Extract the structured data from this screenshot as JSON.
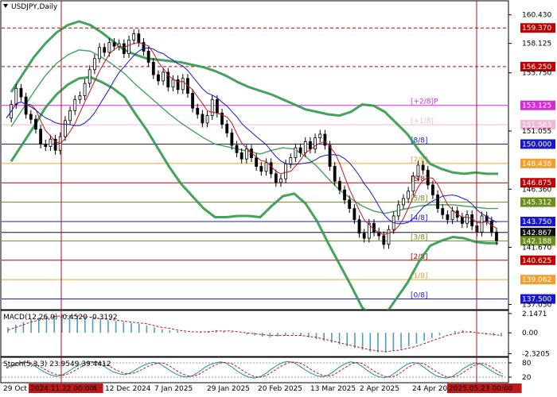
{
  "chart_data": [
    {
      "type": "candlestick",
      "title": "USDJPY,Daily",
      "ylim": [
        136.7,
        161.5
      ],
      "y_ticks": [
        "160.430",
        "158.125",
        "155.750",
        "153.125",
        "151.055",
        "148.438",
        "146.360",
        "143.750",
        "141.670",
        "139.062",
        "137.050"
      ],
      "x_ticks": [
        "29 Oct 2024",
        "2024.11.22 00:00",
        "4",
        "12 Dec 2024",
        "7 Jan 2025",
        "29 Jan 2025",
        "20 Feb 2025",
        "13 Mar 2025",
        "2 Apr 2025",
        "24 Apr 2025",
        "2025.05.23 00:00"
      ],
      "x_highlight_ticks": [
        "2024.11.22 00:00",
        "2025.05.23 00:00"
      ],
      "close_series": [
        152.1,
        153.2,
        154.5,
        153.8,
        152.4,
        152.0,
        151.2,
        150.0,
        149.8,
        150.4,
        149.5,
        150.6,
        151.9,
        152.7,
        153.6,
        153.9,
        154.9,
        156.0,
        156.9,
        157.8,
        157.4,
        158.2,
        157.9,
        158.1,
        157.3,
        158.4,
        158.9,
        158.2,
        157.5,
        156.6,
        155.6,
        155.1,
        155.8,
        154.6,
        155.2,
        154.4,
        155.3,
        154.1,
        152.9,
        152.4,
        151.7,
        152.3,
        153.6,
        152.5,
        151.6,
        150.9,
        149.9,
        149.3,
        148.8,
        149.6,
        148.9,
        148.2,
        147.8,
        148.5,
        147.6,
        146.9,
        147.2,
        148.4,
        148.9,
        149.7,
        149.3,
        150.2,
        149.6,
        150.5,
        150.8,
        149.9,
        148.2,
        147.0,
        146.3,
        145.5,
        144.8,
        143.9,
        142.8,
        142.4,
        143.6,
        142.9,
        142.6,
        141.9,
        143.1,
        144.2,
        145.1,
        145.6,
        146.2,
        147.4,
        148.3,
        147.9,
        146.7,
        145.9,
        144.8,
        144.3,
        143.9,
        144.6,
        144.1,
        143.6,
        144.3,
        143.4,
        142.9,
        144.2,
        143.8,
        142.9,
        142.2
      ],
      "bollinger": {
        "upper": [
          154.2,
          155.6,
          157.0,
          158.1,
          159.0,
          159.6,
          159.9,
          159.6,
          159.0,
          158.3,
          157.6,
          157.2,
          156.9,
          156.8,
          156.7,
          156.6,
          156.4,
          156.2,
          155.9,
          155.5,
          155.0,
          154.6,
          154.3,
          154.0,
          153.6,
          153.2,
          152.8,
          152.6,
          152.4,
          152.3,
          152.6,
          153.2,
          153.1,
          152.6,
          151.7,
          150.8,
          149.5,
          148.4,
          148.0,
          147.7,
          147.6,
          147.7,
          147.6,
          147.6
        ],
        "middle": [
          151.4,
          152.8,
          154.2,
          155.5,
          156.5,
          157.2,
          157.6,
          157.5,
          157.0,
          156.4,
          155.7,
          154.8,
          154.0,
          153.2,
          152.4,
          151.7,
          151.1,
          150.5,
          150.0,
          149.8,
          149.6,
          149.4,
          149.2,
          149.5,
          149.7,
          149.6,
          149.0,
          148.2,
          147.2,
          146.3,
          145.6,
          145.0,
          144.6,
          144.4,
          144.6,
          144.8,
          145.0,
          145.1,
          145.1,
          145.1,
          145.0,
          144.9,
          144.8,
          144.8
        ],
        "lower": [
          148.6,
          150.0,
          151.4,
          152.9,
          154.0,
          154.8,
          155.3,
          155.4,
          155.0,
          154.5,
          153.8,
          152.4,
          151.1,
          149.6,
          148.1,
          146.8,
          145.8,
          144.8,
          144.1,
          144.1,
          144.2,
          144.2,
          144.1,
          145.0,
          145.8,
          146.0,
          145.2,
          143.8,
          142.0,
          140.3,
          138.6,
          136.8,
          136.1,
          136.2,
          137.5,
          138.8,
          140.5,
          141.8,
          142.2,
          142.5,
          142.4,
          142.1,
          142.0,
          142.0
        ]
      },
      "levels": [
        {
          "value": 160.43,
          "label": "160.430",
          "kind": "tick"
        },
        {
          "value": 159.37,
          "label": "159.370",
          "kind": "tag",
          "color": "#c00000",
          "line": "#c00000",
          "style": "dash"
        },
        {
          "value": 158.125,
          "label": "158.125",
          "kind": "tick"
        },
        {
          "value": 156.25,
          "label": "156.250",
          "kind": "tag",
          "color": "#c00000",
          "line": "#c00000",
          "style": "dash"
        },
        {
          "value": 155.75,
          "label": "155.750",
          "kind": "tick"
        },
        {
          "value": 153.125,
          "label": "153.125",
          "kind": "tag",
          "color": "#d42cd4",
          "line": "#d42cd4",
          "style": "solid",
          "murrey": "[+2/8]P",
          "murrey_color": "#d42cd4"
        },
        {
          "value": 151.563,
          "label": "151.563",
          "kind": "tag",
          "color": "#f3b7d6",
          "line": "#f3b7d6",
          "style": "solid",
          "murrey": "[+1/8]",
          "murrey_color": "#f3b7d6"
        },
        {
          "value": 151.055,
          "label": "151.055",
          "kind": "tick"
        },
        {
          "value": 150.0,
          "label": "150.000",
          "kind": "tag",
          "color": "#1818c8",
          "line": "#1818c8",
          "style": "solid",
          "murrey": "[8/8]",
          "murrey_color": "#1818c8"
        },
        {
          "value": 148.438,
          "label": "148.438",
          "kind": "tag",
          "color": "#f0a030",
          "line": "#f0a030",
          "style": "solid",
          "murrey": "[7/8]",
          "murrey_color": "#f0a030"
        },
        {
          "value": 146.875,
          "label": "146.875",
          "kind": "tag",
          "color": "#c00000",
          "line": "#c00000",
          "style": "solid",
          "murrey": "[6/8]",
          "murrey_color": "#c00000"
        },
        {
          "value": 146.36,
          "label": "146.360",
          "kind": "tick"
        },
        {
          "value": 145.312,
          "label": "145.312",
          "kind": "tag",
          "color": "#6e8c1c",
          "line": "#6e8c1c",
          "style": "solid",
          "murrey": "[5/8]",
          "murrey_color": "#6e8c1c"
        },
        {
          "value": 143.75,
          "label": "143.750",
          "kind": "tag",
          "color": "#1818c8",
          "line": "#1818c8",
          "style": "solid",
          "murrey": "[4/8]",
          "murrey_color": "#1818c8"
        },
        {
          "value": 142.867,
          "label": "142.867",
          "kind": "tag",
          "color": "#111111",
          "line": "#111111",
          "style": "solid"
        },
        {
          "value": 142.188,
          "label": "142.188",
          "kind": "tag",
          "color": "#6e8c1c",
          "line": "#6e8c1c",
          "style": "solid",
          "murrey": "[3/8]",
          "murrey_color": "#6e8c1c"
        },
        {
          "value": 141.67,
          "label": "141.670",
          "kind": "tick"
        },
        {
          "value": 140.625,
          "label": "140.625",
          "kind": "tag",
          "color": "#c00000",
          "line": "#c00000",
          "style": "solid",
          "murrey": "[2/8]",
          "murrey_color": "#c00000"
        },
        {
          "value": 139.062,
          "label": "139.062",
          "kind": "tag",
          "color": "#f0a030",
          "line": "#f0a030",
          "style": "solid",
          "murrey": "[1/8]",
          "murrey_color": "#f0a030"
        },
        {
          "value": 137.5,
          "label": "137.500",
          "kind": "tag",
          "color": "#1818c8",
          "line": "#1818c8",
          "style": "solid",
          "murrey": "[0/8]",
          "murrey_color": "#1818c8"
        },
        {
          "value": 137.05,
          "label": "137.050",
          "kind": "tick"
        }
      ]
    },
    {
      "type": "histogram",
      "title": "MACD(12,26,9) -0.4520 -0.3192",
      "y_ticks": [
        "2.1471",
        "0.00",
        "-2.3205"
      ],
      "ylim": [
        -2.55,
        2.4
      ],
      "values": [
        0.6,
        0.9,
        1.2,
        1.5,
        1.7,
        1.9,
        2.0,
        2.1,
        2.0,
        1.9,
        1.8,
        1.6,
        1.5,
        1.4,
        1.3,
        1.2,
        1.1,
        1.0,
        0.8,
        0.6,
        0.4,
        0.3,
        0.2,
        0.1,
        0.0,
        0.1,
        0.2,
        0.3,
        0.2,
        0.1,
        0.0,
        -0.2,
        -0.3,
        -0.4,
        -0.5,
        -0.4,
        -0.3,
        -0.2,
        -0.3,
        -0.5,
        -0.7,
        -0.9,
        -1.1,
        -1.3,
        -1.5,
        -1.7,
        -1.9,
        -2.1,
        -2.2,
        -2.2,
        -2.0,
        -1.8,
        -1.5,
        -1.2,
        -0.9,
        -0.6,
        -0.3,
        0.0,
        0.2,
        0.3,
        0.2,
        0.0,
        -0.2,
        -0.3,
        -0.4
      ],
      "signal": [
        0.3,
        0.6,
        0.9,
        1.2,
        1.4,
        1.6,
        1.8,
        1.9,
        1.9,
        1.9,
        1.8,
        1.7,
        1.6,
        1.5,
        1.4,
        1.3,
        1.2,
        1.1,
        1.0,
        0.8,
        0.6,
        0.5,
        0.3,
        0.2,
        0.1,
        0.1,
        0.1,
        0.2,
        0.2,
        0.2,
        0.1,
        0.0,
        -0.1,
        -0.2,
        -0.3,
        -0.3,
        -0.3,
        -0.3,
        -0.3,
        -0.4,
        -0.5,
        -0.7,
        -0.9,
        -1.1,
        -1.3,
        -1.5,
        -1.7,
        -1.9,
        -2.0,
        -2.1,
        -2.0,
        -1.9,
        -1.7,
        -1.5,
        -1.2,
        -0.9,
        -0.6,
        -0.3,
        -0.1,
        0.1,
        0.1,
        0.0,
        -0.1,
        -0.2,
        -0.3
      ]
    },
    {
      "type": "line",
      "title": "Stoch(5,3,3) 23.9549 39.4412",
      "y_ticks": [
        "80",
        "20"
      ],
      "ylim": [
        0,
        100
      ],
      "k": [
        62,
        70,
        78,
        84,
        80,
        68,
        52,
        38,
        28,
        24,
        30,
        44,
        60,
        72,
        80,
        86,
        82,
        70,
        55,
        42,
        34,
        30,
        38,
        52,
        66,
        76,
        82,
        78,
        64,
        48,
        34,
        24,
        20,
        26,
        40,
        58,
        72,
        80,
        84,
        78,
        62,
        44,
        30,
        20,
        16,
        22,
        36,
        54,
        70,
        82,
        86,
        80,
        66,
        50,
        36,
        26,
        22,
        28,
        44,
        62,
        76,
        84,
        80,
        66,
        48,
        32,
        22,
        18,
        24,
        40,
        58,
        74,
        82,
        78,
        62,
        44,
        28,
        20,
        16,
        22,
        38,
        56,
        70,
        80,
        76,
        62,
        46,
        32,
        24
      ],
      "d": [
        58,
        64,
        72,
        80,
        82,
        76,
        64,
        50,
        38,
        30,
        28,
        34,
        46,
        60,
        72,
        80,
        84,
        80,
        70,
        56,
        44,
        36,
        34,
        40,
        52,
        64,
        74,
        80,
        78,
        66,
        50,
        36,
        26,
        24,
        30,
        44,
        58,
        72,
        80,
        82,
        76,
        62,
        46,
        32,
        22,
        20,
        26,
        40,
        56,
        70,
        80,
        84,
        80,
        68,
        52,
        38,
        28,
        24,
        30,
        44,
        60,
        74,
        82,
        78,
        64,
        48,
        34,
        24,
        20,
        26,
        40,
        58,
        72,
        80,
        76,
        62,
        46,
        32,
        22,
        20,
        26,
        40,
        56,
        70,
        78,
        74,
        62,
        46,
        34
      ]
    }
  ]
}
